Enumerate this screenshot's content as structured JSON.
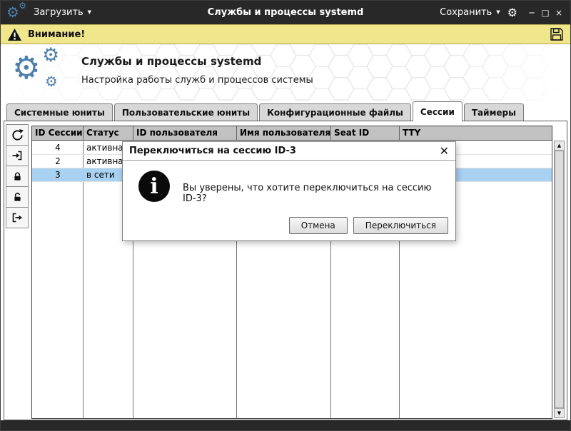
{
  "titlebar": {
    "load_label": "Загрузить",
    "title": "Службы и процессы systemd",
    "save_label": "Сохранить"
  },
  "warning": {
    "label": "Внимание!"
  },
  "header": {
    "title": "Службы и процессы systemd",
    "subtitle": "Настройка работы служб и процессов системы"
  },
  "tabs": [
    {
      "label": "Системные юниты",
      "active": false
    },
    {
      "label": "Пользовательские юниты",
      "active": false
    },
    {
      "label": "Конфигурационные файлы",
      "active": false
    },
    {
      "label": "Сессии",
      "active": true
    },
    {
      "label": "Таймеры",
      "active": false
    }
  ],
  "table": {
    "columns": [
      "ID Сессии",
      "Статус",
      "ID пользователя",
      "Имя пользователя",
      "Seat ID",
      "TTY"
    ],
    "rows": [
      {
        "id": "4",
        "status": "активна",
        "user_id": "",
        "user_name": "",
        "seat_id": "",
        "tty": "",
        "selected": false
      },
      {
        "id": "2",
        "status": "активна",
        "user_id": "",
        "user_name": "",
        "seat_id": "",
        "tty": "",
        "selected": false
      },
      {
        "id": "3",
        "status": "в сети",
        "user_id": "",
        "user_name": "",
        "seat_id": "",
        "tty": "",
        "selected": true
      }
    ]
  },
  "dialog": {
    "title": "Переключиться на сессию ID-3",
    "message": "Вы уверены, что хотите переключиться на сессию ID-3?",
    "cancel_label": "Отмена",
    "confirm_label": "Переключиться"
  },
  "icons": {
    "app_logo": "gears",
    "menu_caret": "chevron-down",
    "titlebar_settings": "gear",
    "window_controls": [
      "minimize",
      "maximize",
      "close"
    ],
    "warning": "warning-triangle",
    "warning_bar_right": "floppy-disk-save",
    "toolbar": [
      "refresh",
      "switch-to-session",
      "lock-session",
      "unlock-session",
      "terminate-session"
    ],
    "dialog_info": "info-circle",
    "dialog_close": "close-x",
    "scrollbar": [
      "arrow-up",
      "arrow-down"
    ]
  },
  "colors": {
    "titlebar_bg": "#282828",
    "accent_blue": "#4d7fad",
    "warning_bg": "#f0e68c",
    "selection_bg": "#a9d1f1",
    "tab_inactive_bg": "#d8d8d8",
    "table_header_bg": "#c2c2c2"
  }
}
